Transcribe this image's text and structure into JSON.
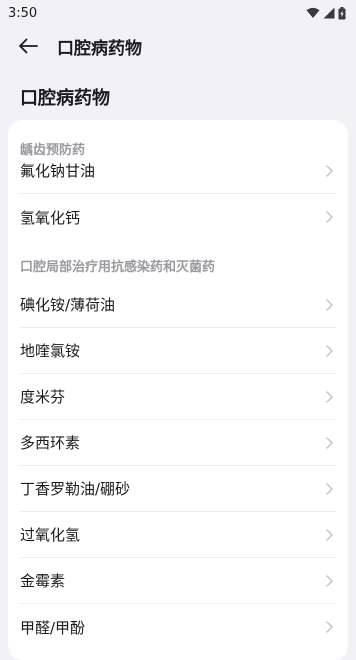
{
  "status_bar": {
    "time": "3:50"
  },
  "app_bar": {
    "title": "口腔病药物"
  },
  "page": {
    "heading": "口腔病药物"
  },
  "sections": [
    {
      "title": "龋齿预防药",
      "items": [
        "氟化钠甘油",
        "氢氧化钙"
      ]
    },
    {
      "title": "口腔局部治疗用抗感染药和灭菌药",
      "items": [
        "碘化铵/薄荷油",
        "地喹氯铵",
        "度米芬",
        "多西环素",
        "丁香罗勒油/硼砂",
        "过氧化氢",
        "金霉素",
        "甲醛/甲酚"
      ]
    }
  ],
  "colors": {
    "background": "#f2f2f6",
    "card": "#ffffff",
    "section_title": "#9a9aa0"
  }
}
